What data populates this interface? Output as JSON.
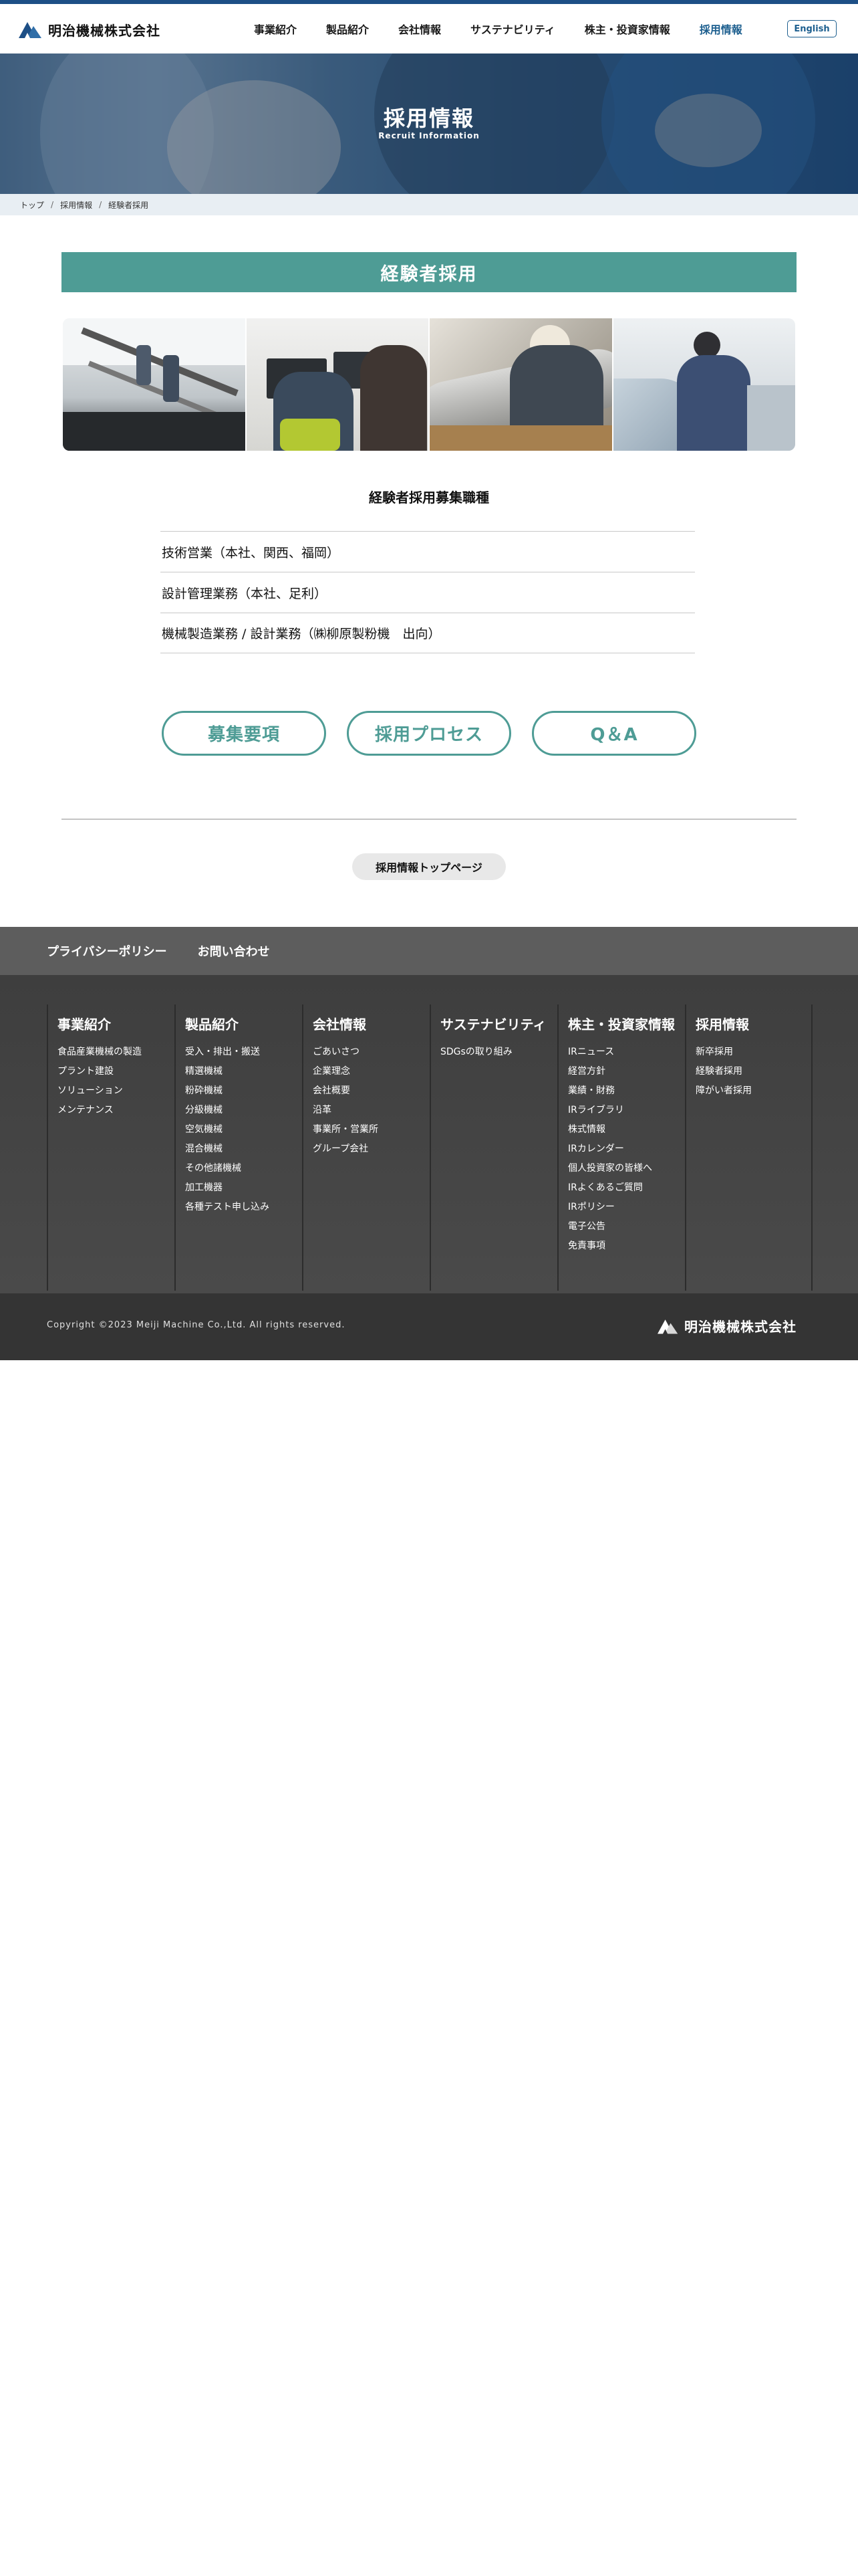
{
  "header": {
    "logo_text": "明治機械株式会社",
    "nav": [
      {
        "label": "事業紹介"
      },
      {
        "label": "製品紹介"
      },
      {
        "label": "会社情報"
      },
      {
        "label": "サステナビリティ"
      },
      {
        "label": "株主・投資家情報"
      },
      {
        "label": "採用情報"
      }
    ],
    "active_nav": "採用情報",
    "lang_button": "English"
  },
  "hero": {
    "title": "採用情報",
    "subtitle": "Recruit Information"
  },
  "breadcrumb": [
    "トップ",
    "採用情報",
    "経験者採用"
  ],
  "section": {
    "heading": "経験者採用",
    "photos": [
      "stairs-workers-photo",
      "office-desk-photo",
      "machine-inspection-photo",
      "vehicle-check-photo"
    ],
    "jobs_title": "経験者採用募集職種",
    "jobs": [
      "技術営業（本社、関西、福岡）",
      "設計管理業務（本社、足利）",
      "機械製造業務 / 設計業務（㈱柳原製粉機　出向）"
    ],
    "buttons": [
      "募集要項",
      "採用プロセス",
      "Q＆A"
    ],
    "top_page_button": "採用情報トップページ"
  },
  "footer": {
    "links": [
      "プライバシーポリシー",
      "お問い合わせ"
    ],
    "columns": [
      {
        "title": "事業紹介",
        "items": [
          "食品産業機械の製造",
          "プラント建設",
          "ソリューション",
          "メンテナンス"
        ]
      },
      {
        "title": "製品紹介",
        "items": [
          "受入・排出・搬送",
          "精選機械",
          "粉砕機械",
          "分級機械",
          "空気機械",
          "混合機械",
          "その他諸機械",
          "加工機器",
          "各種テスト申し込み"
        ]
      },
      {
        "title": "会社情報",
        "items": [
          "ごあいさつ",
          "企業理念",
          "会社概要",
          "沿革",
          "事業所・営業所",
          "グループ会社"
        ]
      },
      {
        "title": "サステナビリティ",
        "items": [
          "SDGsの取り組み"
        ]
      },
      {
        "title": "株主・投資家情報",
        "items": [
          "IRニュース",
          "経営方針",
          "業績・財務",
          "IRライブラリ",
          "株式情報",
          "IRカレンダー",
          "個人投資家の皆様へ",
          "IRよくあるご質問",
          "IRポリシー",
          "電子公告",
          "免責事項"
        ]
      },
      {
        "title": "採用情報",
        "items": [
          "新卒採用",
          "経験者採用",
          "障がい者採用"
        ]
      }
    ],
    "copyright": "Copyright ©2023 Meiji Machine Co.,Ltd. All rights reserved.",
    "logo_text": "明治機械株式会社"
  },
  "colors": {
    "brand_blue": "#1d5f8f",
    "accent_teal": "#4e9c95",
    "footer_dark": "#3e3e3e"
  }
}
